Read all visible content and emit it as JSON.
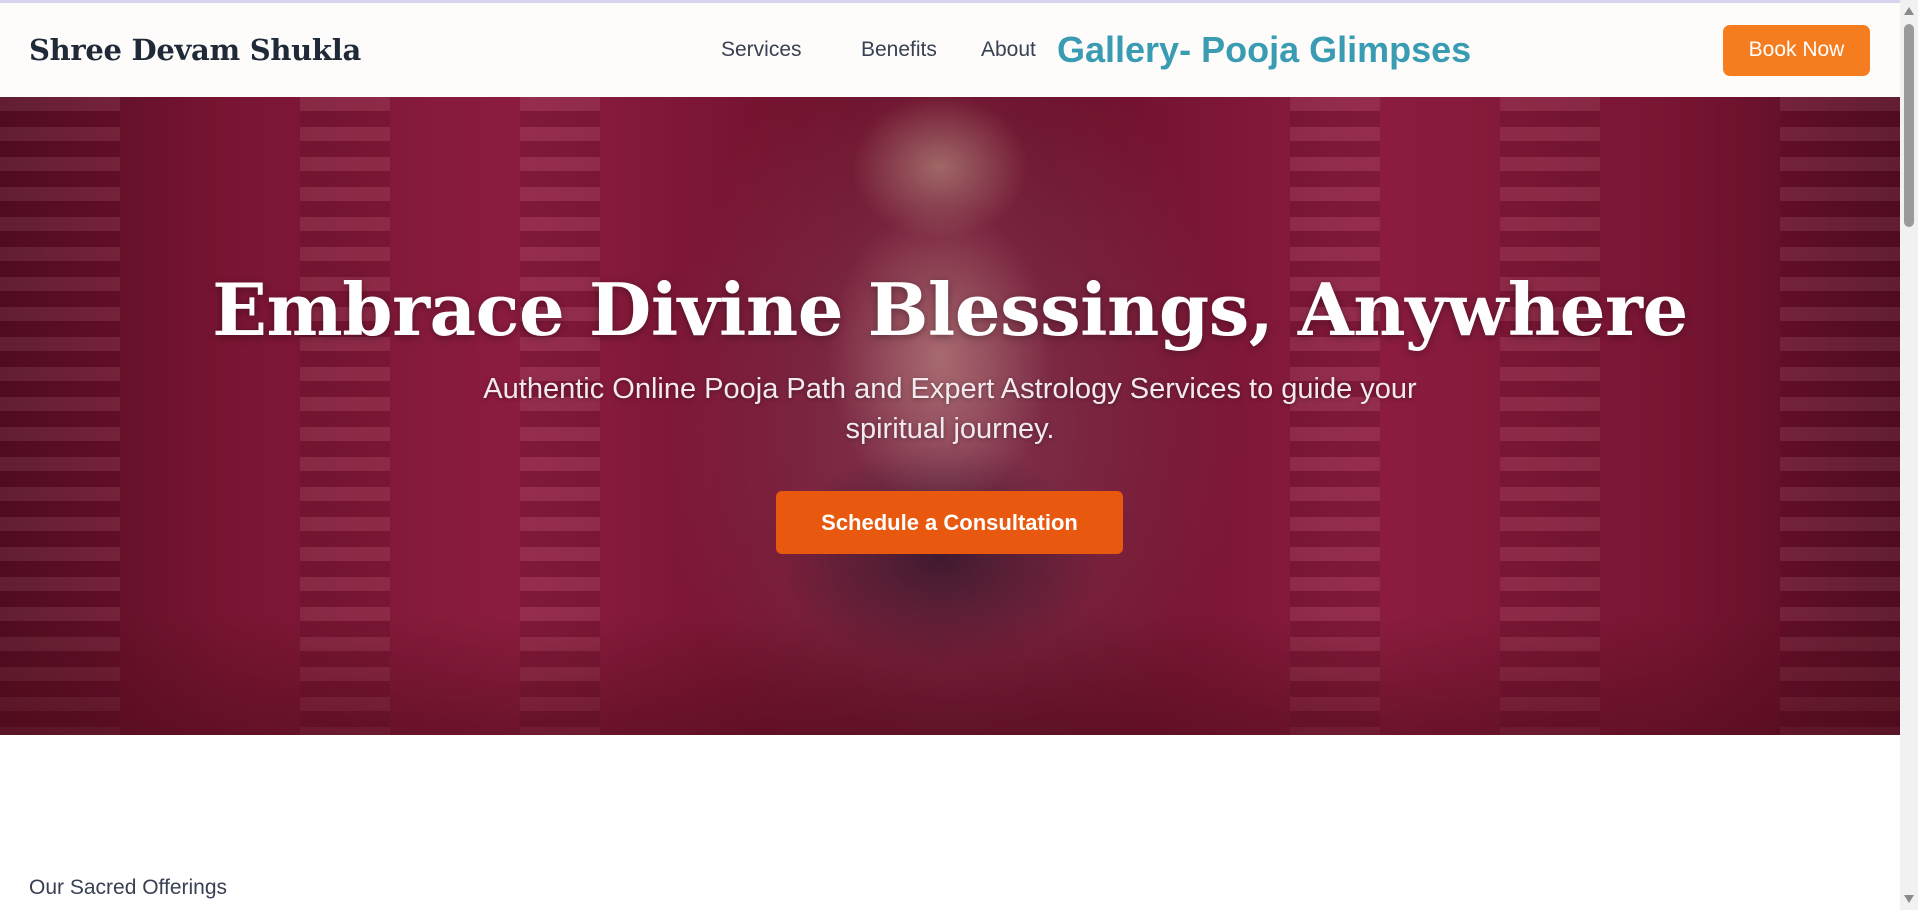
{
  "header": {
    "brand": "Shree Devam Shukla",
    "nav": {
      "services": "Services",
      "benefits": "Benefits",
      "about": "About",
      "gallery": "Gallery- Pooja Glimpses"
    },
    "book_label": "Book Now"
  },
  "hero": {
    "title": "Embrace Divine Blessings, Anywhere",
    "subtitle": "Authentic Online Pooja Path and Expert Astrology Services to guide your spiritual journey.",
    "cta_label": "Schedule a Consultation"
  },
  "offerings": {
    "label": "Our Sacred Offerings"
  },
  "colors": {
    "accent": "#f57c1f",
    "cta": "#e8580f",
    "gallery_link": "#3a9cb2",
    "brand_text": "#1f2937"
  }
}
